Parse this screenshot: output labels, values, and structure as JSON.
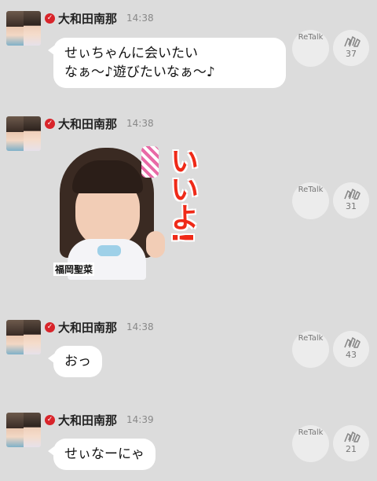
{
  "messages": [
    {
      "sender": "大和田南那",
      "time": "14:38",
      "type": "text",
      "text": "せぃちゃんに会いたい\nなぁ〜♪遊びたいなぁ〜♪",
      "retalk_label": "ReTalk",
      "clap_count": "37"
    },
    {
      "sender": "大和田南那",
      "time": "14:38",
      "type": "sticker",
      "sticker_text": "いいよ!",
      "sticker_caption": "福岡聖菜",
      "retalk_label": "ReTalk",
      "clap_count": "31"
    },
    {
      "sender": "大和田南那",
      "time": "14:38",
      "type": "text",
      "text": "おっ",
      "retalk_label": "ReTalk",
      "clap_count": "43"
    },
    {
      "sender": "大和田南那",
      "time": "14:39",
      "type": "text",
      "text": "せぃなーにゃ",
      "retalk_label": "ReTalk",
      "clap_count": "21"
    }
  ],
  "colors": {
    "background": "#dcdcdc",
    "badge": "#d8242a",
    "sticker_text": "#ef2a18"
  },
  "icons": {
    "badge": "check-badge-icon",
    "clap": "clap-hands-icon"
  }
}
